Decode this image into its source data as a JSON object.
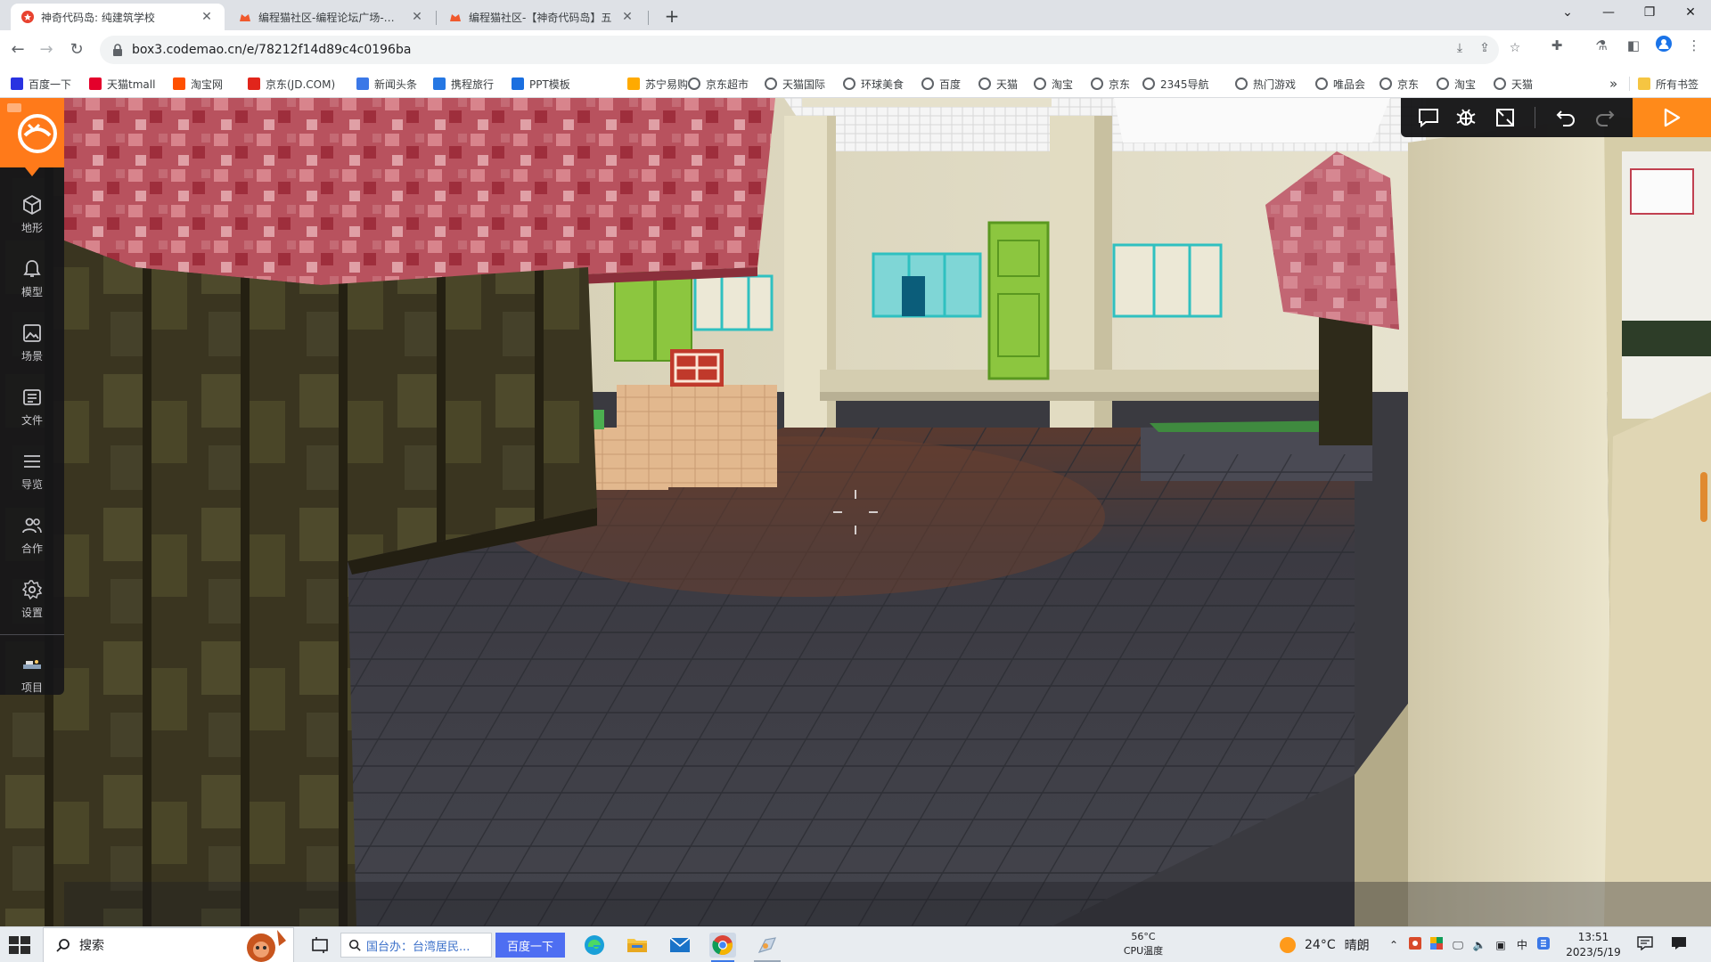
{
  "browser": {
    "tabs": [
      {
        "title": "神奇代码岛: 纯建筑学校",
        "active": true
      },
      {
        "title": "编程猫社区-编程论坛广场-编程",
        "active": false
      },
      {
        "title": "编程猫社区-【神奇代码岛】五",
        "active": false
      }
    ],
    "address": "box3.codemao.cn/e/78212f14d89c4c0196ba",
    "bookmarks": [
      {
        "label": "百度一下",
        "icon": "baidu-icon",
        "color": "#2932e1"
      },
      {
        "label": "天猫tmall",
        "icon": "tmall-icon",
        "color": "#e4002b"
      },
      {
        "label": "淘宝网",
        "icon": "taobao-icon",
        "color": "#ff5000"
      },
      {
        "label": "京东(JD.COM)",
        "icon": "jd-icon",
        "color": "#e1251b"
      },
      {
        "label": "新闻头条",
        "icon": "news-icon",
        "color": "#3b78e7"
      },
      {
        "label": "携程旅行",
        "icon": "ctrip-icon",
        "color": "#2577e3"
      },
      {
        "label": "PPT模板",
        "icon": "ppt-icon",
        "color": "#1a6fe0"
      },
      {
        "label": "苏宁易购",
        "icon": "suning-icon",
        "color": "#ffaa00"
      },
      {
        "label": "京东超市",
        "icon": "globe-icon",
        "color": "#5f6368"
      },
      {
        "label": "天猫国际",
        "icon": "globe-icon",
        "color": "#5f6368"
      },
      {
        "label": "环球美食",
        "icon": "globe-icon",
        "color": "#5f6368"
      },
      {
        "label": "百度",
        "icon": "globe-icon",
        "color": "#5f6368"
      },
      {
        "label": "天猫",
        "icon": "globe-icon",
        "color": "#5f6368"
      },
      {
        "label": "淘宝",
        "icon": "globe-icon",
        "color": "#5f6368"
      },
      {
        "label": "京东",
        "icon": "globe-icon",
        "color": "#5f6368"
      },
      {
        "label": "2345导航",
        "icon": "globe-icon",
        "color": "#5f6368"
      },
      {
        "label": "热门游戏",
        "icon": "globe-icon",
        "color": "#5f6368"
      },
      {
        "label": "唯品会",
        "icon": "globe-icon",
        "color": "#5f6368"
      },
      {
        "label": "京东",
        "icon": "globe-icon",
        "color": "#5f6368"
      },
      {
        "label": "淘宝",
        "icon": "globe-icon",
        "color": "#5f6368"
      },
      {
        "label": "天猫",
        "icon": "globe-icon",
        "color": "#5f6368"
      }
    ],
    "more_bookmarks": "»",
    "all_bookmarks": "所有书签"
  },
  "editor": {
    "sidebar": [
      {
        "label": "地形",
        "icon": "cube-icon"
      },
      {
        "label": "模型",
        "icon": "bell-icon"
      },
      {
        "label": "场景",
        "icon": "image-icon"
      },
      {
        "label": "文件",
        "icon": "file-list-icon"
      },
      {
        "label": "导览",
        "icon": "list-icon"
      },
      {
        "label": "合作",
        "icon": "people-icon"
      },
      {
        "label": "设置",
        "icon": "gear-icon"
      },
      {
        "label": "项目",
        "icon": "project-icon"
      }
    ],
    "accent": "#ff7a1a"
  },
  "taskbar": {
    "search_label": "搜索",
    "news_text": "国台办：台湾居民...",
    "news_button": "百度一下",
    "cpu_temp": "56°C",
    "cpu_label": "CPU温度",
    "weather_temp": "24°C",
    "weather_desc": "晴朗",
    "ime": "中",
    "time": "13:51",
    "date": "2023/5/19"
  }
}
